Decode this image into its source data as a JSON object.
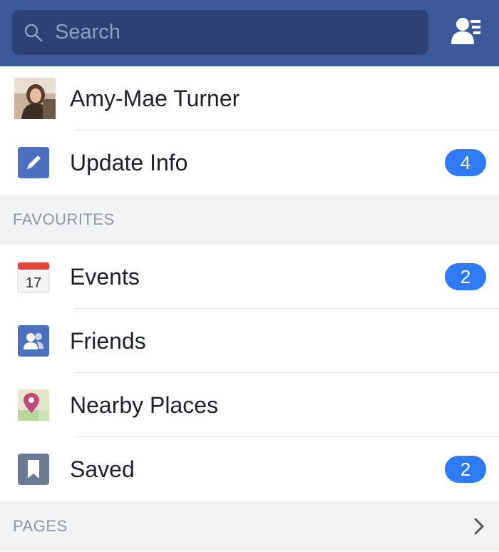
{
  "header": {
    "search_placeholder": "Search",
    "search_icon": "search-icon",
    "friend_requests_icon": "friend-requests-icon",
    "bar_color": "#3b5998"
  },
  "profile": {
    "name": "Amy-Mae Turner",
    "avatar": "avatar"
  },
  "update_info": {
    "label": "Update Info",
    "badge": "4",
    "icon": "pencil-icon"
  },
  "favourites": {
    "title": "FAVOURITES",
    "items": [
      {
        "label": "Events",
        "badge": "2",
        "icon": "calendar-icon",
        "calendar_day": "17"
      },
      {
        "label": "Friends",
        "badge": "",
        "icon": "friends-icon"
      },
      {
        "label": "Nearby Places",
        "badge": "",
        "icon": "map-pin-icon"
      },
      {
        "label": "Saved",
        "badge": "2",
        "icon": "bookmark-icon"
      }
    ]
  },
  "pages": {
    "title": "PAGES",
    "chevron": "chevron-right-icon"
  },
  "colors": {
    "badge": "#2f7bf5",
    "section_bg": "#f1f2f4"
  }
}
